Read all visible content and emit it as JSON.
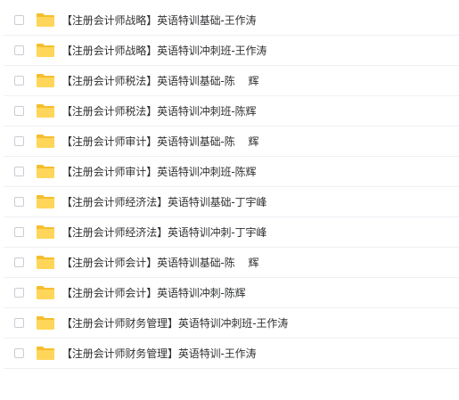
{
  "files": [
    {
      "name": "【注册会计师战略】英语特训基础-王作涛"
    },
    {
      "name": "【注册会计师战略】英语特训冲刺班-王作涛"
    },
    {
      "name": "【注册会计师税法】英语特训基础-陈    辉"
    },
    {
      "name": "【注册会计师税法】英语特训冲刺班-陈辉"
    },
    {
      "name": "【注册会计师审计】英语特训基础-陈    辉"
    },
    {
      "name": "【注册会计师审计】英语特训冲刺班-陈辉"
    },
    {
      "name": "【注册会计师经济法】英语特训基础-丁宇峰"
    },
    {
      "name": "【注册会计师经济法】英语特训冲刺-丁宇峰"
    },
    {
      "name": "【注册会计师会计】英语特训基础-陈    辉"
    },
    {
      "name": "【注册会计师会计】英语特训冲刺-陈辉"
    },
    {
      "name": "【注册会计师财务管理】英语特训冲刺班-王作涛"
    },
    {
      "name": "【注册会计师财务管理】英语特训-王作涛"
    }
  ],
  "icons": {
    "folder": "folder-icon",
    "checkbox": "checkbox"
  },
  "colors": {
    "folder_body": "#FFD659",
    "folder_back": "#F5BE2C",
    "row_divider": "#eef0f4",
    "checkbox_border": "#c8ccd4",
    "text": "#303133"
  }
}
